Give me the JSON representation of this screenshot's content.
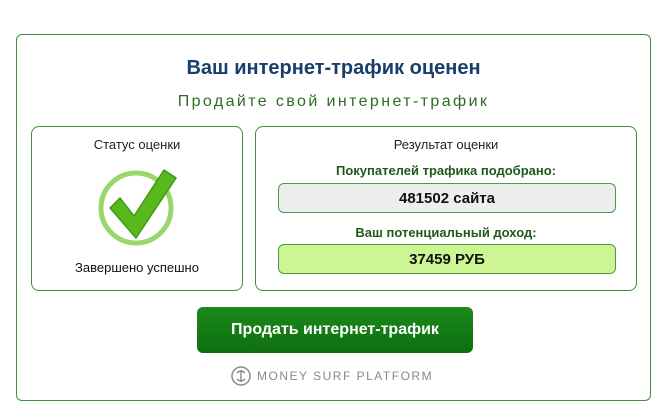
{
  "card": {
    "title": "Ваш интернет-трафик оценен",
    "subtitle": "Продайте свой интернет-трафик"
  },
  "status_panel": {
    "heading": "Статус оценки",
    "status_text": "Завершено успешно",
    "icon": "check-circle-icon"
  },
  "result_panel": {
    "heading": "Результат оценки",
    "buyers_label": "Покупателей трафика подобрано:",
    "buyers_value": "481502 сайта",
    "income_label": "Ваш потенциальный доход:",
    "income_value": "37459 РУБ"
  },
  "sell_button": {
    "label": "Продать интернет-трафик"
  },
  "brand": {
    "name": "MONEY SURF PLATFORM",
    "icon": "money-surf-logo-icon"
  },
  "colors": {
    "accent_green": "#0d6e0d",
    "border_green": "#3f8f3f",
    "title_blue": "#173f6b",
    "income_highlight": "#cdf593"
  }
}
